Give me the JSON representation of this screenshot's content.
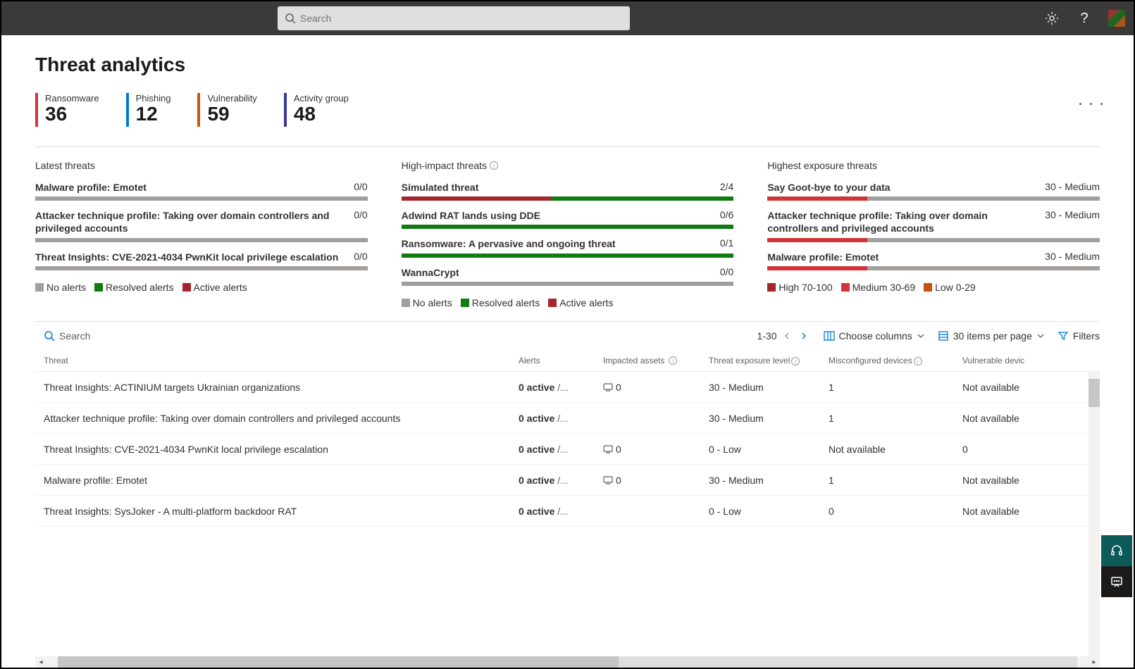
{
  "header": {
    "search_placeholder": "Search"
  },
  "page": {
    "title": "Threat analytics"
  },
  "stats": [
    {
      "label": "Ransomware",
      "value": "36",
      "color": "#d13438"
    },
    {
      "label": "Phishing",
      "value": "12",
      "color": "#0078d4"
    },
    {
      "label": "Vulnerability",
      "value": "59",
      "color": "#ca5010"
    },
    {
      "label": "Activity group",
      "value": "48",
      "color": "#393897"
    }
  ],
  "panels": {
    "latest": {
      "title": "Latest threats",
      "items": [
        {
          "title": "Malware profile: Emotet",
          "metric": "0/0",
          "segments": [
            {
              "color": "#a19f9d",
              "pct": 100
            }
          ]
        },
        {
          "title": "Attacker technique profile: Taking over domain controllers and privileged accounts",
          "metric": "0/0",
          "segments": [
            {
              "color": "#a19f9d",
              "pct": 100
            }
          ]
        },
        {
          "title": "Threat Insights: CVE-2021-4034 PwnKit local privilege escalation",
          "metric": "0/0",
          "segments": [
            {
              "color": "#a19f9d",
              "pct": 100
            }
          ]
        }
      ],
      "legend": [
        {
          "label": "No alerts",
          "color": "#a19f9d"
        },
        {
          "label": "Resolved alerts",
          "color": "#107c10"
        },
        {
          "label": "Active alerts",
          "color": "#a4262c"
        }
      ]
    },
    "high_impact": {
      "title": "High-impact threats",
      "items": [
        {
          "title": "Simulated threat",
          "metric": "2/4",
          "segments": [
            {
              "color": "#a4262c",
              "pct": 45
            },
            {
              "color": "#107c10",
              "pct": 55
            }
          ]
        },
        {
          "title": "Adwind RAT lands using DDE",
          "metric": "0/6",
          "segments": [
            {
              "color": "#107c10",
              "pct": 100
            }
          ]
        },
        {
          "title": "Ransomware: A pervasive and ongoing threat",
          "metric": "0/1",
          "segments": [
            {
              "color": "#107c10",
              "pct": 100
            }
          ]
        },
        {
          "title": "WannaCrypt",
          "metric": "0/0",
          "segments": [
            {
              "color": "#a19f9d",
              "pct": 100
            }
          ]
        }
      ],
      "legend": [
        {
          "label": "No alerts",
          "color": "#a19f9d"
        },
        {
          "label": "Resolved alerts",
          "color": "#107c10"
        },
        {
          "label": "Active alerts",
          "color": "#a4262c"
        }
      ]
    },
    "exposure": {
      "title": "Highest exposure threats",
      "items": [
        {
          "title": "Say Goot-bye to your data",
          "metric": "30 - Medium",
          "segments": [
            {
              "color": "#d13438",
              "pct": 30
            },
            {
              "color": "#a19f9d",
              "pct": 70
            }
          ]
        },
        {
          "title": "Attacker technique profile: Taking over domain controllers and privileged accounts",
          "metric": "30 - Medium",
          "segments": [
            {
              "color": "#d13438",
              "pct": 30
            },
            {
              "color": "#a19f9d",
              "pct": 70
            }
          ]
        },
        {
          "title": "Malware profile: Emotet",
          "metric": "30 - Medium",
          "segments": [
            {
              "color": "#d13438",
              "pct": 30
            },
            {
              "color": "#a19f9d",
              "pct": 70
            }
          ]
        }
      ],
      "legend": [
        {
          "label": "High 70-100",
          "color": "#a4262c"
        },
        {
          "label": "Medium 30-69",
          "color": "#d13438"
        },
        {
          "label": "Low 0-29",
          "color": "#ca5010"
        }
      ]
    }
  },
  "toolbar": {
    "search_label": "Search",
    "pager": "1-30",
    "choose_columns": "Choose columns",
    "items_per_page": "30 items per page",
    "filters": "Filters"
  },
  "table": {
    "columns": {
      "threat": "Threat",
      "alerts": "Alerts",
      "assets": "Impacted assets",
      "exposure": "Threat exposure level",
      "misc": "Misconfigured devices",
      "vuln": "Vulnerable devic"
    },
    "rows": [
      {
        "threat": "Threat Insights: ACTINIUM targets Ukrainian organizations",
        "alerts_b": "0 active",
        "alerts_g": " /...",
        "assets": "0",
        "exposure": "30 - Medium",
        "misc": "1",
        "vuln": "Not available"
      },
      {
        "threat": "Attacker technique profile: Taking over domain controllers and privileged accounts",
        "alerts_b": "0 active",
        "alerts_g": " /...",
        "assets": "",
        "exposure": "30 - Medium",
        "misc": "1",
        "vuln": "Not available"
      },
      {
        "threat": "Threat Insights: CVE-2021-4034 PwnKit local privilege escalation",
        "alerts_b": "0 active",
        "alerts_g": " /...",
        "assets": "0",
        "exposure": "0 - Low",
        "misc": "Not available",
        "vuln": "0"
      },
      {
        "threat": "Malware profile: Emotet",
        "alerts_b": "0 active",
        "alerts_g": " /...",
        "assets": "0",
        "exposure": "30 - Medium",
        "misc": "1",
        "vuln": "Not available"
      },
      {
        "threat": "Threat Insights: SysJoker - A multi-platform backdoor RAT",
        "alerts_b": "0 active",
        "alerts_g": " /...",
        "assets": "",
        "exposure": "0 - Low",
        "misc": "0",
        "vuln": "Not available"
      }
    ]
  }
}
